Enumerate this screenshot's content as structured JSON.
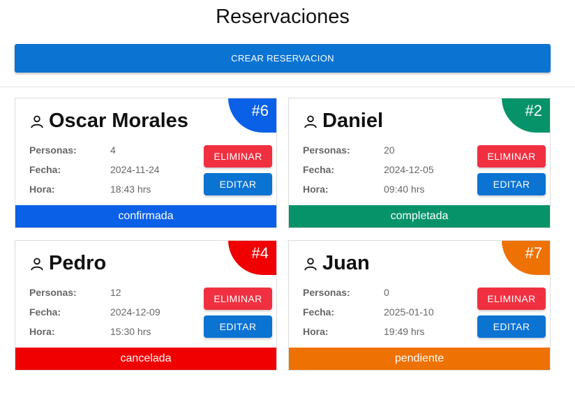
{
  "header": {
    "title": "Reservaciones",
    "create_label": "CREAR RESERVACION"
  },
  "labels": {
    "personas": "Personas:",
    "fecha": "Fecha:",
    "hora": "Hora:"
  },
  "buttons": {
    "delete": "ELIMINAR",
    "edit": "EDITAR"
  },
  "reservations": [
    {
      "name": "Oscar Morales",
      "id": "#6",
      "personas": "4",
      "fecha": "2024-11-24",
      "hora": "18:43 hrs",
      "status": "confirmada",
      "color": "#0a60e6"
    },
    {
      "name": "Daniel",
      "id": "#2",
      "personas": "20",
      "fecha": "2024-12-05",
      "hora": "09:40 hrs",
      "status": "completada",
      "color": "#07936a"
    },
    {
      "name": "Pedro",
      "id": "#4",
      "personas": "12",
      "fecha": "2024-12-09",
      "hora": "15:30 hrs",
      "status": "cancelada",
      "color": "#f00000"
    },
    {
      "name": "Juan",
      "id": "#7",
      "personas": "0",
      "fecha": "2025-01-10",
      "hora": "19:49 hrs",
      "status": "pendiente",
      "color": "#ee7104"
    }
  ]
}
